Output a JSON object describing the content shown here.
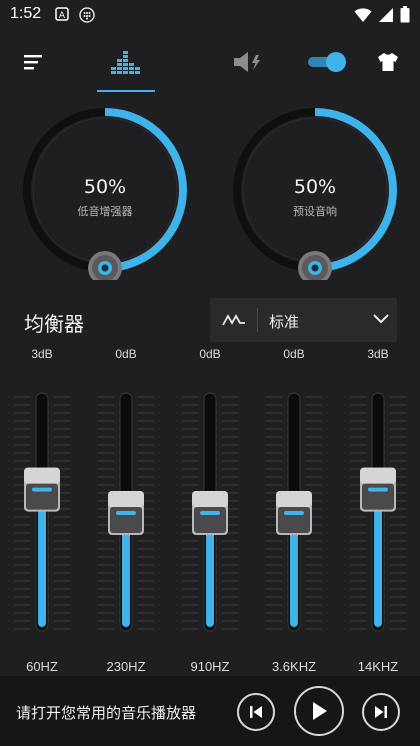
{
  "status_bar": {
    "time": "1:52"
  },
  "toolbar": {
    "icons": [
      "menu-icon",
      "equalizer-icon",
      "volume-boost-icon",
      "toggle-switch",
      "theme-shirt-icon"
    ],
    "active_tab": "equalizer",
    "toggle_on": true
  },
  "knobs": [
    {
      "value": "50%",
      "label": "低音增强器",
      "level": 0.5
    },
    {
      "value": "50%",
      "label": "预设音响",
      "level": 0.5
    }
  ],
  "equalizer": {
    "title": "均衡器",
    "preset": "标准",
    "bands": [
      {
        "db": "3dB",
        "freq": "60HZ",
        "gain": 3
      },
      {
        "db": "0dB",
        "freq": "230HZ",
        "gain": 0
      },
      {
        "db": "0dB",
        "freq": "910HZ",
        "gain": 0
      },
      {
        "db": "0dB",
        "freq": "3.6KHZ",
        "gain": 0
      },
      {
        "db": "3dB",
        "freq": "14KHZ",
        "gain": 3
      }
    ]
  },
  "player": {
    "prompt": "请打开您常用的音乐播放器"
  },
  "colors": {
    "accent": "#3fb3ea",
    "background": "#1f1f21",
    "bottom_bar": "#161617"
  }
}
